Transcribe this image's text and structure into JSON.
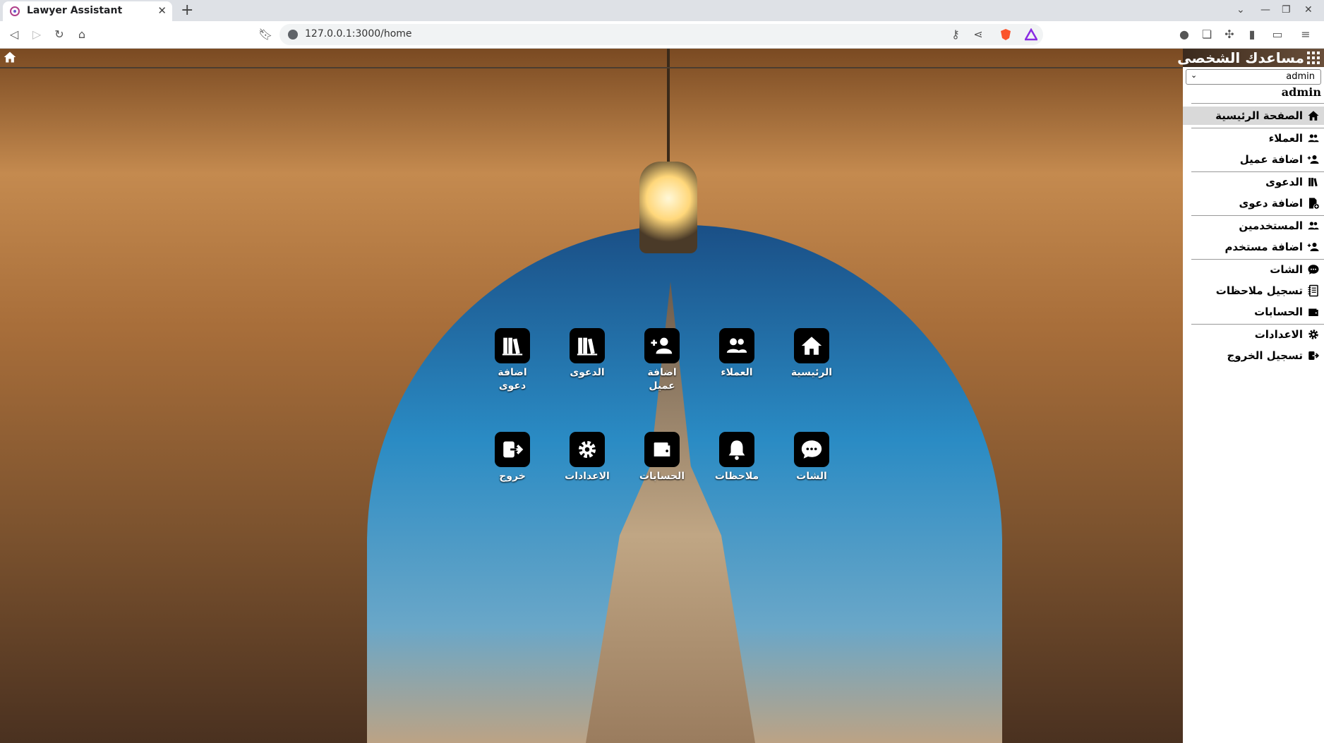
{
  "browser": {
    "tab_title": "Lawyer Assistant",
    "url": "127.0.0.1:3000/home"
  },
  "app": {
    "title": "مساعدك الشخصى",
    "user_select": {
      "selected": "admin"
    },
    "username": "admin"
  },
  "sidebar": {
    "items": [
      {
        "label": "الصفحة الرئيسية",
        "icon": "home-icon",
        "active": true
      },
      {
        "label": "العملاء",
        "icon": "users-icon"
      },
      {
        "label": "اضافة عميل",
        "icon": "user-plus-icon"
      },
      {
        "label": "الدعوى",
        "icon": "books-icon"
      },
      {
        "label": "اضافة دعوى",
        "icon": "file-plus-icon"
      },
      {
        "label": "المستخدمين",
        "icon": "users-icon"
      },
      {
        "label": "اضافة مستخدم",
        "icon": "user-plus-icon"
      },
      {
        "label": "الشات",
        "icon": "chat-icon"
      },
      {
        "label": "تسجيل ملاحظات",
        "icon": "notebook-icon"
      },
      {
        "label": "الحسابات",
        "icon": "wallet-icon"
      },
      {
        "label": "الاعدادات",
        "icon": "gear-icon"
      },
      {
        "label": "تسجيل الخروج",
        "icon": "logout-icon"
      }
    ]
  },
  "tiles": [
    {
      "label": "الرئيسية",
      "icon": "home-icon"
    },
    {
      "label": "العملاء",
      "icon": "users-icon"
    },
    {
      "label": "اضافة عميل",
      "icon": "user-plus-icon"
    },
    {
      "label": "الدعوى",
      "icon": "books-icon"
    },
    {
      "label": "اضافة دعوى",
      "icon": "books-icon"
    },
    {
      "label": "الشات",
      "icon": "chat-icon"
    },
    {
      "label": "ملاحظات",
      "icon": "bell-icon"
    },
    {
      "label": "الحسابات",
      "icon": "wallet-icon"
    },
    {
      "label": "الاعدادات",
      "icon": "gear-icon"
    },
    {
      "label": "خروج",
      "icon": "logout-icon"
    }
  ]
}
